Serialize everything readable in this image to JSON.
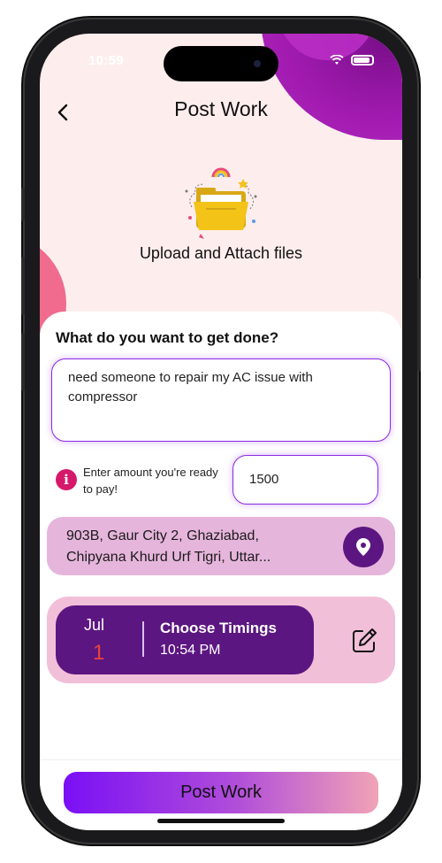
{
  "status_bar": {
    "time": "10:59"
  },
  "header": {
    "title": "Post Work"
  },
  "upload": {
    "label": "Upload and Attach files"
  },
  "form": {
    "question": "What do you want to get done?",
    "description_value": "need someone to repair my AC issue with compressor",
    "amount_hint": "Enter amount you're ready to pay!",
    "amount_value": "1500",
    "address_line1": "903B, Gaur City 2, Ghaziabad,",
    "address_line2": "Chipyana Khurd Urf Tigri, Uttar..."
  },
  "timing": {
    "month": "Jul",
    "day": "1",
    "title": "Choose Timings",
    "time": "10:54 PM"
  },
  "footer": {
    "post_label": "Post Work"
  },
  "icons": {
    "back": "chevron-left-icon",
    "info": "info-icon",
    "location": "location-pin-icon",
    "edit": "edit-icon"
  },
  "colors": {
    "accent": "#5c1681",
    "highlight": "#8a2be2",
    "info": "#d6186a",
    "day": "#e8453c"
  }
}
